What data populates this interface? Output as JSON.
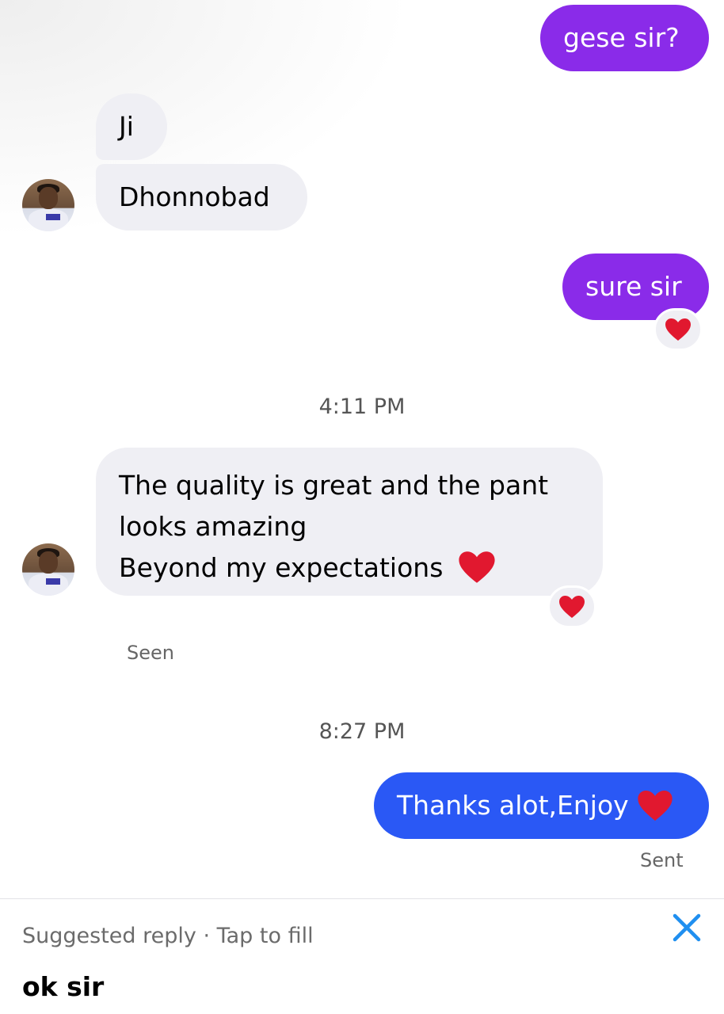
{
  "messages": {
    "m1": "gese sir?",
    "m2": "Ji",
    "m3": "Dhonnobad",
    "m4": "sure sir",
    "m5_line1": "The quality is great and the pant",
    "m5_line2": "looks amazing",
    "m5_line3": "Beyond my expectations",
    "m6": "Thanks alot,Enjoy"
  },
  "timestamps": {
    "t1": "4:11 PM",
    "t2": "8:27 PM"
  },
  "status": {
    "seen": "Seen",
    "sent": "Sent"
  },
  "suggested_reply": {
    "label": "Suggested reply · Tap to fill",
    "text": "ok sir"
  },
  "colors": {
    "outgoing_purple": "#8a2be9",
    "outgoing_blue": "#2a58f5",
    "incoming_bg": "#efeff4",
    "close_icon": "#1f8ff0",
    "heart": "#e1182f"
  },
  "icons": {
    "reaction": "red-heart-icon",
    "close": "close-icon"
  }
}
